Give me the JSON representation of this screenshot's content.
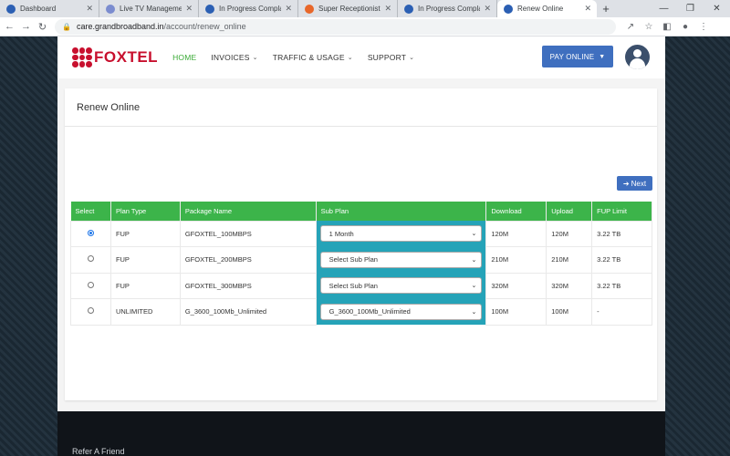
{
  "browser": {
    "tabs": [
      {
        "label": "Dashboard",
        "favicon_color": "#2b5fb3",
        "active": false
      },
      {
        "label": "Live TV Management-C",
        "favicon_color": "#7b8ccf",
        "active": false
      },
      {
        "label": "In Progress Complaints",
        "favicon_color": "#2b5fb3",
        "active": false
      },
      {
        "label": "Super Receptionist",
        "favicon_color": "#e8672a",
        "active": false
      },
      {
        "label": "In Progress Complaints",
        "favicon_color": "#2b5fb3",
        "active": false
      },
      {
        "label": "Renew Online",
        "favicon_color": "#2b5fb3",
        "active": true
      }
    ],
    "url_host": "care.grandbroadband.in",
    "url_path": "/account/renew_online"
  },
  "header": {
    "logo_text": "FOXTEL",
    "menu": [
      {
        "label": "HOME",
        "has_dropdown": false,
        "active": true
      },
      {
        "label": "INVOICES",
        "has_dropdown": true
      },
      {
        "label": "TRAFFIC & USAGE",
        "has_dropdown": true
      },
      {
        "label": "SUPPORT",
        "has_dropdown": true
      }
    ],
    "pay_label": "PAY ONLINE"
  },
  "card": {
    "title": "Renew Online",
    "next_label": "Next"
  },
  "table": {
    "columns": [
      "Select",
      "Plan Type",
      "Package Name",
      "Sub Plan",
      "Download",
      "Upload",
      "FUP Limit"
    ],
    "rows": [
      {
        "selected": true,
        "plan_type": "FUP",
        "package": "GFOXTEL_100MBPS",
        "sub_plan": "1 Month",
        "download": "120M",
        "upload": "120M",
        "fup": "3.22 TB"
      },
      {
        "selected": false,
        "plan_type": "FUP",
        "package": "GFOXTEL_200MBPS",
        "sub_plan": "Select Sub Plan",
        "download": "210M",
        "upload": "210M",
        "fup": "3.22 TB"
      },
      {
        "selected": false,
        "plan_type": "FUP",
        "package": "GFOXTEL_300MBPS",
        "sub_plan": "Select Sub Plan",
        "download": "320M",
        "upload": "320M",
        "fup": "3.22 TB"
      },
      {
        "selected": false,
        "plan_type": "UNLIMITED",
        "package": "G_3600_100Mb_Unlimited",
        "sub_plan": "G_3600_100Mb_Unlimited",
        "download": "100M",
        "upload": "100M",
        "fup": "-"
      }
    ]
  },
  "footer": {
    "refer_label": "Refer A Friend"
  },
  "colors": {
    "brand_red": "#c8102e",
    "header_green": "#3cb44a",
    "subplan_teal": "#25a3b8",
    "button_blue": "#3f6fbf"
  }
}
